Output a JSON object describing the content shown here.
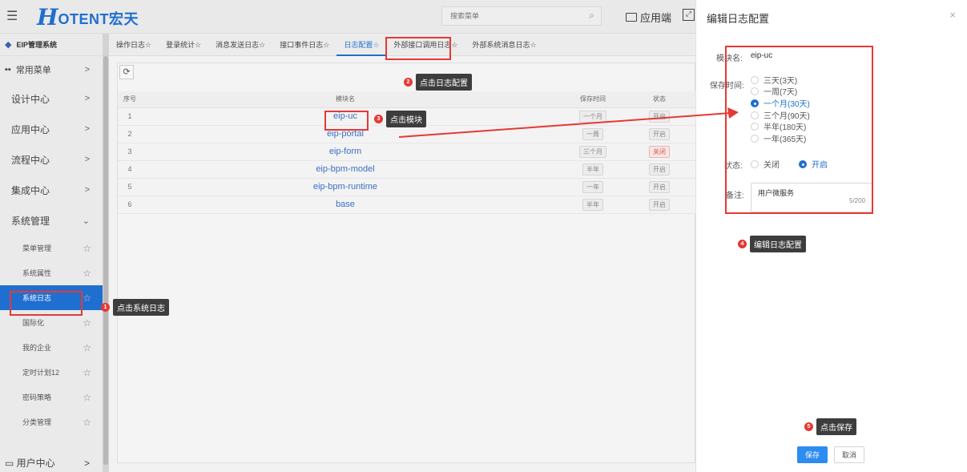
{
  "header": {
    "logo_h": "H",
    "logo_rest": "OTENT宏天",
    "search_placeholder": "搜索菜单",
    "app_label": "应用端",
    "menu_icon": "hamburger-icon",
    "search_icon": "search-icon",
    "fullscreen_icon": "fullscreen-icon"
  },
  "sidebar": {
    "system_title": "EIP管理系统",
    "common_label": "常用菜单",
    "groups": [
      {
        "label": "设计中心"
      },
      {
        "label": "应用中心"
      },
      {
        "label": "流程中心"
      },
      {
        "label": "集成中心"
      },
      {
        "label": "系统管理"
      }
    ],
    "sub_items": [
      {
        "label": "菜单管理"
      },
      {
        "label": "系统属性"
      },
      {
        "label": "系统日志"
      },
      {
        "label": "国际化"
      },
      {
        "label": "我的企业"
      },
      {
        "label": "定时计划12"
      },
      {
        "label": "密码策略"
      },
      {
        "label": "分类管理"
      }
    ],
    "bottom_label": "用户中心"
  },
  "tabs": [
    {
      "label": "操作日志☆"
    },
    {
      "label": "登录统计☆"
    },
    {
      "label": "消息发送日志☆"
    },
    {
      "label": "接口事件日志☆"
    },
    {
      "label": "日志配置☆"
    },
    {
      "label": "外部接口调用日志☆"
    },
    {
      "label": "外部系统消息日志☆"
    }
  ],
  "table": {
    "columns": {
      "idx": "序号",
      "module": "模块名",
      "keep": "保存时间",
      "status": "状态"
    },
    "rows": [
      {
        "idx": "1",
        "module": "eip-uc",
        "keep": "一个月",
        "status": "开启"
      },
      {
        "idx": "2",
        "module": "eip-portal",
        "keep": "一周",
        "status": "开启"
      },
      {
        "idx": "3",
        "module": "eip-form",
        "keep": "三个月",
        "status": "关闭"
      },
      {
        "idx": "4",
        "module": "eip-bpm-model",
        "keep": "半年",
        "status": "开启"
      },
      {
        "idx": "5",
        "module": "eip-bpm-runtime",
        "keep": "一年",
        "status": "开启"
      },
      {
        "idx": "6",
        "module": "base",
        "keep": "半年",
        "status": "开启"
      }
    ]
  },
  "annotations": {
    "c1": {
      "num": "1",
      "text": "点击系统日志"
    },
    "c2": {
      "num": "2",
      "text": "点击日志配置"
    },
    "c3": {
      "num": "3",
      "text": "点击模块"
    },
    "c4": {
      "num": "4",
      "text": "编辑日志配置"
    },
    "c5": {
      "num": "5",
      "text": "点击保存"
    }
  },
  "drawer": {
    "title": "编辑日志配置",
    "close": "×",
    "module_label": "模块名:",
    "module_value": "eip-uc",
    "keep_label": "保存时间:",
    "keep_options": [
      {
        "label": "三天(3天)",
        "selected": false
      },
      {
        "label": "一周(7天)",
        "selected": false
      },
      {
        "label": "一个月(30天)",
        "selected": true
      },
      {
        "label": "三个月(90天)",
        "selected": false
      },
      {
        "label": "半年(180天)",
        "selected": false
      },
      {
        "label": "一年(365天)",
        "selected": false
      }
    ],
    "status_label": "状态:",
    "status_off": "关闭",
    "status_on": "开启",
    "status_value": "开启",
    "remark_label": "备注:",
    "remark_value": "用户微服务",
    "remark_counter": "5/200",
    "save": "保存",
    "cancel": "取消"
  },
  "colors": {
    "accent": "#1f6fd0",
    "annotation": "#e53935",
    "save_button": "#2d8cf0"
  }
}
